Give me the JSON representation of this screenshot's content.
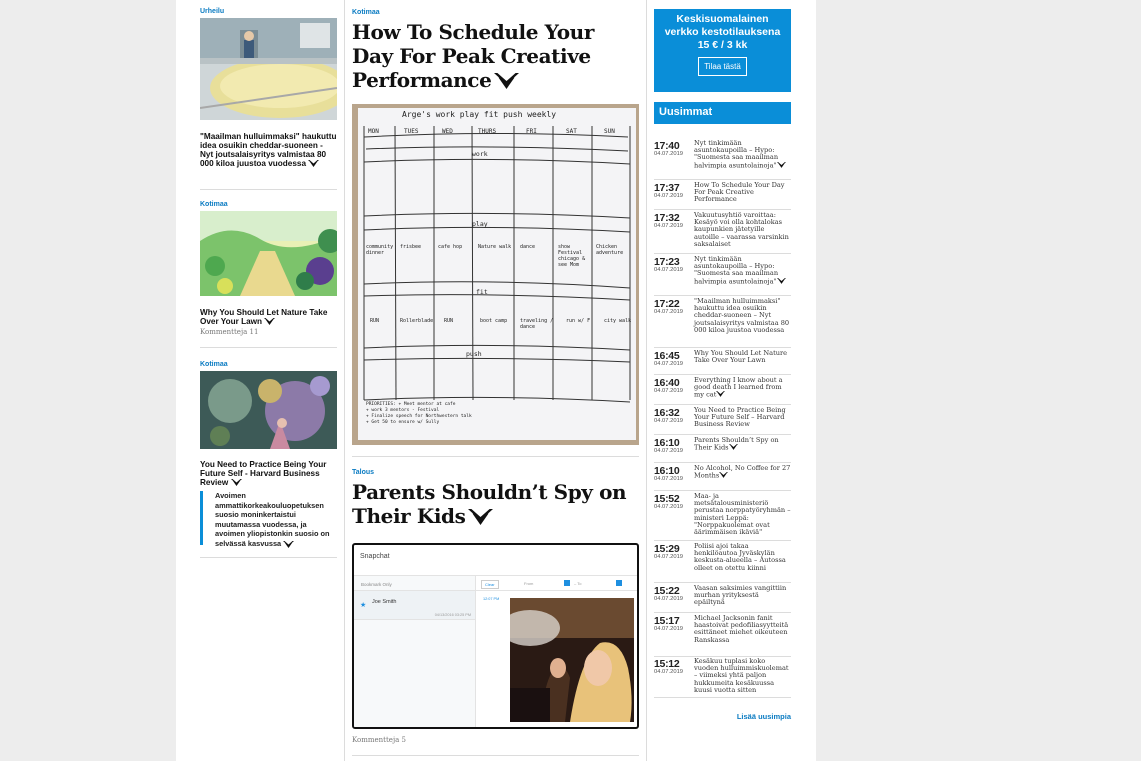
{
  "left": {
    "cards": [
      {
        "category": "Urheilu",
        "title": "\"Maailman hulluimmaksi\" haukuttu idea osuikin cheddar-suoneen - Nyt joutsalaisyritys valmistaa 80 000 kiloa juustoa vuodessa",
        "meta": ""
      },
      {
        "category": "Kotimaa",
        "title": "Why You Should Let Nature Take Over Your Lawn",
        "meta": "Kommentteja 11"
      },
      {
        "category": "Kotimaa",
        "title": "You Need to Practice Being Your Future Self - Harvard Business Review",
        "meta": ""
      }
    ],
    "related": "Avoimen ammattikorkeakouluopetuksen suosio moninkertaistui muutamassa vuodessa, ja avoimen yliopistonkin suosio on selvässä kasvussa"
  },
  "middle": {
    "article1": {
      "category": "Kotimaa",
      "title": "How To Schedule Your Day For Peak Creative Performance"
    },
    "whiteboard": {
      "heading": "Arge's work play fit push weekly",
      "days": [
        "MON",
        "TUES",
        "WED",
        "THURS",
        "FRI",
        "SAT",
        "SUN"
      ],
      "sections": [
        "work",
        "play",
        "fit",
        "push"
      ],
      "play_cells": [
        "community dinner",
        "frisbee",
        "cafe hop",
        "Nature walk",
        "dance",
        "show Festival chicago & see Mom",
        "Chicken adventure"
      ],
      "fit_cells": [
        "RUN",
        "Rollerblade",
        "RUN",
        "boot camp",
        "traveling / dance",
        "run w/ F",
        "city walk"
      ],
      "priorities": [
        "PRIORITIES: + Meet mentor at cafe",
        "+ work 3 mentors - Festival",
        "+ Finalize speech for Northwestern talk",
        "+ Get 50 to ensure w/ Sully"
      ]
    },
    "article2": {
      "category": "Talous",
      "title": "Parents Shouldn’t Spy on Their Kids",
      "meta": "Kommentteja 5"
    },
    "snapchat": {
      "app_title": "Snapchat",
      "tab": "Bookmark Only",
      "contact": "Joe Smith",
      "contact_date": "04/13/2016 03:25 PM",
      "clear_label": "Clear",
      "from_label": "From",
      "to_label": "To",
      "timestamp": "12:07 PM"
    }
  },
  "right": {
    "promo": {
      "line1": "Keskisuomalainen",
      "line2": "verkko kestotilauksena",
      "price": "15 € / 3 kk",
      "button": "Tilaa tästä"
    },
    "section_title": "Uusimmat",
    "news": [
      {
        "time": "17:40",
        "date": "04.07.2019",
        "headline": "Nyt tinkimään asuntokaupoilla – Hypo: \"Suomesta saa maailman halvimpia asuntolainoja\""
      },
      {
        "time": "17:37",
        "date": "04.07.2019",
        "headline": "How To Schedule Your Day For Peak Creative Performance"
      },
      {
        "time": "17:32",
        "date": "04.07.2019",
        "headline": "Vakuutusyhtiö varoittaa: Kesäyö voi olla kohtalokas kaupunkien jätetyille autoille – vaarassa varsinkin saksalaiset"
      },
      {
        "time": "17:23",
        "date": "04.07.2019",
        "headline": "Nyt tinkimään asuntokaupoilla – Hypo: \"Suomesta saa maailman halvimpia asuntolainoja\""
      },
      {
        "time": "17:22",
        "date": "04.07.2019",
        "headline": "\"Maailman hulluimmaksi\" haukuttu idea osuikin cheddar-suoneen – Nyt joutsalaisyritys valmistaa 80 000 kiloa juustoa vuodessa"
      },
      {
        "time": "16:45",
        "date": "04.07.2019",
        "headline": "Why You Should Let Nature Take Over Your Lawn"
      },
      {
        "time": "16:40",
        "date": "04.07.2019",
        "headline": "Everything I know about a good death I learned from my cat"
      },
      {
        "time": "16:32",
        "date": "04.07.2019",
        "headline": "You Need to Practice Being Your Future Self – Harvard Business Review"
      },
      {
        "time": "16:10",
        "date": "04.07.2019",
        "headline": "Parents Shouldn’t Spy on Their Kids"
      },
      {
        "time": "16:10",
        "date": "04.07.2019",
        "headline": "No Alcohol, No Coffee for 27 Months"
      },
      {
        "time": "15:52",
        "date": "04.07.2019",
        "headline": "Maa- ja metsätalousministeriö perustaa norppatyöryhmän – ministeri Leppä: \"Norppakuolemat ovat äärimmäisen ikäviä\""
      },
      {
        "time": "15:29",
        "date": "04.07.2019",
        "headline": "Poliisi ajoi takaa henkilöautoa Jyväskylän keskusta-alueella – Autossa olleet on otettu kiinni"
      },
      {
        "time": "15:22",
        "date": "04.07.2019",
        "headline": "Vaasan saksimies vangittiin murhan yrityksestä epäiltynä"
      },
      {
        "time": "15:17",
        "date": "04.07.2019",
        "headline": "Michael Jacksonin fanit haastoivat pedofiliasyytteitä esittäneet miehet oikeuteen Ranskassa"
      },
      {
        "time": "15:12",
        "date": "04.07.2019",
        "headline": "Kesäkuu tuplasi koko vuoden hulluimmiskuolemat – viimeksi yhtä paljon hukkumeita kesäkuussa kuusi vuotta sitten"
      }
    ],
    "more": "Lisää uusimpia"
  },
  "colors": {
    "accent": "#0a8ed8",
    "link": "#0a7bc2",
    "background": "#ededed"
  }
}
